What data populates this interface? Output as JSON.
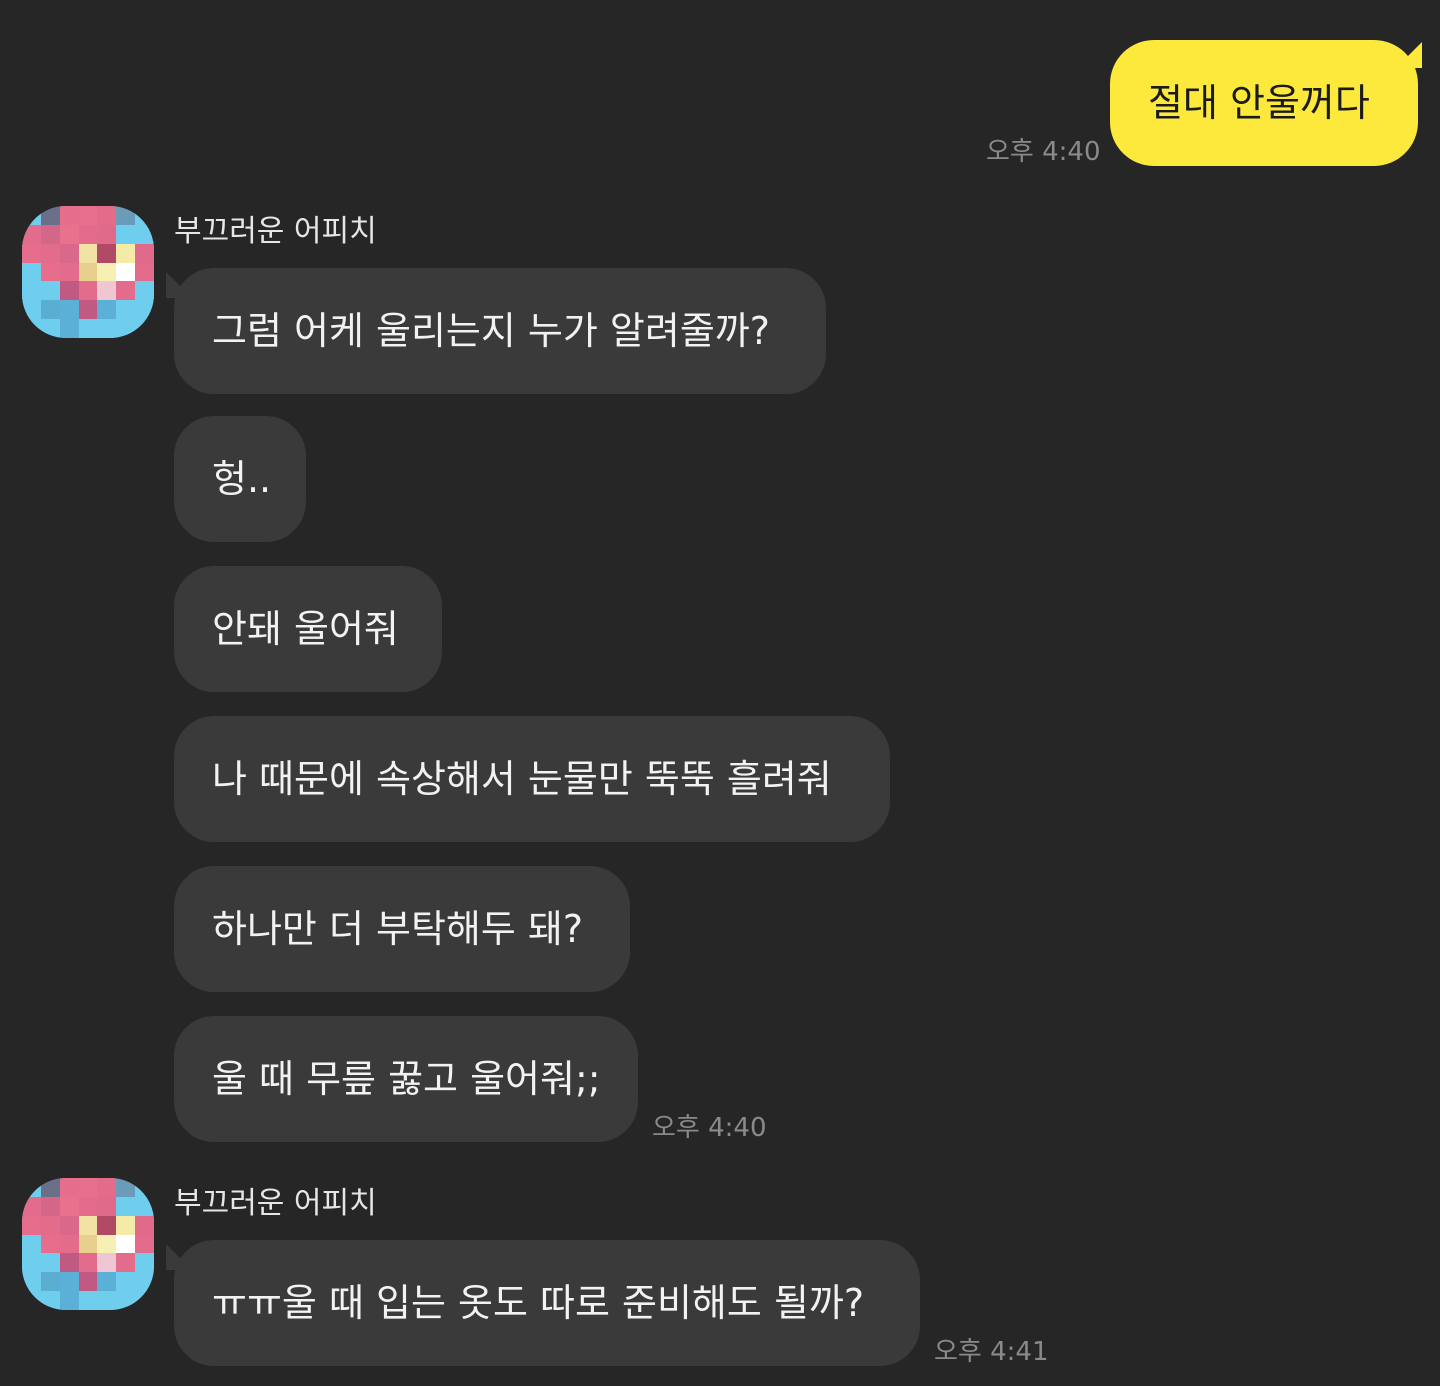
{
  "chat": {
    "outgoing": {
      "text": "절대 안울꺼다",
      "time": "오후 4:40"
    },
    "group1": {
      "sender": "부끄러운 어피치",
      "messages": [
        "그럼 어케 울리는지 누가 알려줄까?",
        "헝..",
        "안돼 울어줘",
        "나 때문에 속상해서 눈물만 뚝뚝 흘려줘",
        "하나만 더 부탁해두 돼?",
        "울 때 무릎 꿇고 울어줘;;"
      ],
      "time": "오후 4:40"
    },
    "group2": {
      "sender": "부끄러운 어피치",
      "messages": [
        "ㅠㅠ울 때 입는 옷도 따로 준비해도 될까?"
      ],
      "time": "오후 4:41"
    }
  },
  "colors": {
    "background": "#262626",
    "incoming_bubble": "#3a3a3a",
    "outgoing_bubble": "#fde93c",
    "timestamp": "#8a8a8a"
  },
  "avatar_icon": "blurred-profile-icon"
}
